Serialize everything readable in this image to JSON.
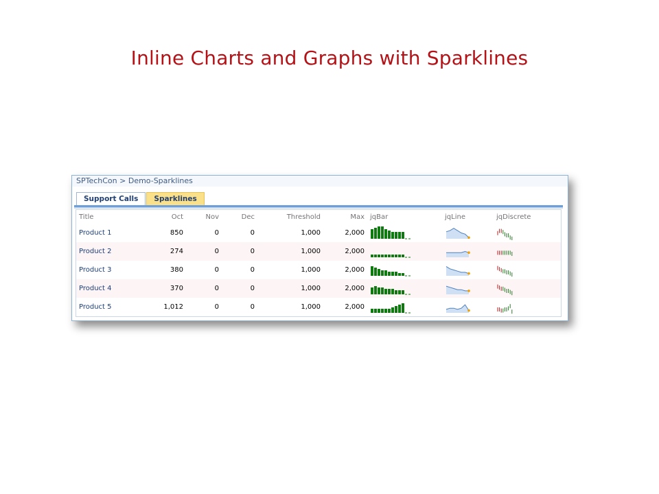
{
  "slide_title": "Inline Charts and Graphs with Sparklines",
  "breadcrumb": "SPTechCon > Demo-Sparklines",
  "tabs": [
    {
      "label": "Support Calls",
      "selected": false
    },
    {
      "label": "Sparklines",
      "selected": true
    }
  ],
  "columns": [
    "Title",
    "Oct",
    "Nov",
    "Dec",
    "Threshold",
    "Max",
    "jqBar",
    "jqLine",
    "jqDiscrete"
  ],
  "rows": [
    {
      "title": "Product 1",
      "oct": "850",
      "nov": "0",
      "dec": "0",
      "threshold": "1,000",
      "max": "2,000",
      "bar": [
        7,
        8,
        9,
        9,
        7,
        6,
        5,
        5,
        5,
        5,
        0,
        0
      ],
      "line": [
        6,
        7,
        9,
        7,
        5,
        4,
        1
      ],
      "discrete": [
        7,
        9,
        9,
        8,
        6,
        5,
        5,
        3,
        2
      ]
    },
    {
      "title": "Product 2",
      "oct": "274",
      "nov": "0",
      "dec": "0",
      "threshold": "1,000",
      "max": "2,000",
      "bar": [
        2,
        2,
        2,
        2,
        2,
        2,
        2,
        2,
        2,
        2,
        0,
        0
      ],
      "line": [
        4,
        4,
        4,
        4,
        4,
        5,
        4
      ],
      "discrete": [
        6,
        6,
        6,
        6,
        6,
        6,
        6,
        6,
        5
      ]
    },
    {
      "title": "Product 3",
      "oct": "380",
      "nov": "0",
      "dec": "0",
      "threshold": "1,000",
      "max": "2,000",
      "bar": [
        7,
        6,
        5,
        4,
        4,
        3,
        3,
        3,
        2,
        2,
        0,
        0
      ],
      "line": [
        8,
        6,
        5,
        4,
        3,
        3,
        2
      ],
      "discrete": [
        9,
        8,
        7,
        6,
        6,
        5,
        5,
        4,
        3
      ]
    },
    {
      "title": "Product 4",
      "oct": "370",
      "nov": "0",
      "dec": "0",
      "threshold": "1,000",
      "max": "2,000",
      "bar": [
        5,
        6,
        5,
        5,
        4,
        4,
        4,
        3,
        3,
        3,
        0,
        0
      ],
      "line": [
        7,
        6,
        5,
        4,
        4,
        3,
        3
      ],
      "discrete": [
        9,
        8,
        7,
        7,
        6,
        5,
        5,
        4,
        3
      ]
    },
    {
      "title": "Product 5",
      "oct": "1,012",
      "nov": "0",
      "dec": "0",
      "threshold": "1,000",
      "max": "2,000",
      "bar": [
        3,
        3,
        3,
        3,
        3,
        3,
        4,
        5,
        6,
        7,
        0,
        0
      ],
      "line": [
        3,
        4,
        4,
        3,
        4,
        7,
        2
      ],
      "discrete": [
        5,
        5,
        4,
        4,
        5,
        5,
        6,
        8,
        3
      ]
    }
  ],
  "colors": {
    "bar": "#0f7a0f",
    "line_fill": "#cfe0f5",
    "line_stroke": "#4f81bd",
    "marker": "#f0a000",
    "discrete_high": "#b22222",
    "discrete_low": "#2a7a2a"
  }
}
